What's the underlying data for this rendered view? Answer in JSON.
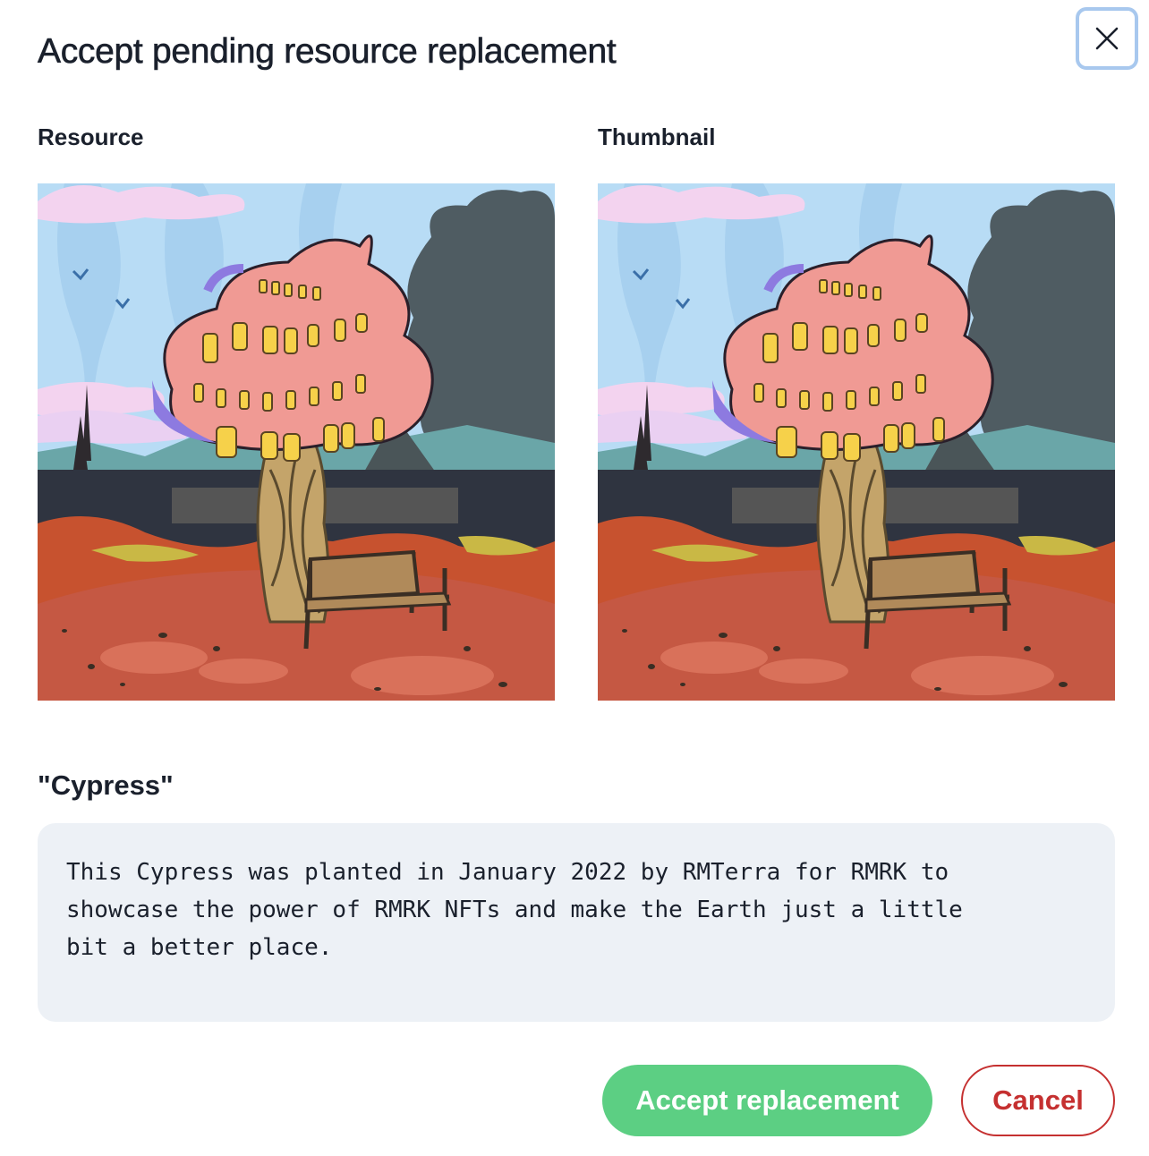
{
  "modal": {
    "title": "Accept pending resource replacement",
    "close_icon": "close-icon"
  },
  "resource": {
    "label": "Resource"
  },
  "thumbnail": {
    "label": "Thumbnail"
  },
  "nft": {
    "name": "\"Cypress\"",
    "description": "This Cypress was planted in January 2022 by RMTerra for RMRK to\nshowcase the power of RMRK NFTs and make the Earth just a little\nbit a better place."
  },
  "actions": {
    "accept_label": "Accept replacement",
    "cancel_label": "Cancel"
  },
  "colors": {
    "accept_bg": "#5ccf83",
    "cancel_fg": "#c53030",
    "description_bg": "#edf1f6",
    "close_focus_ring": "#a8c8ee"
  }
}
